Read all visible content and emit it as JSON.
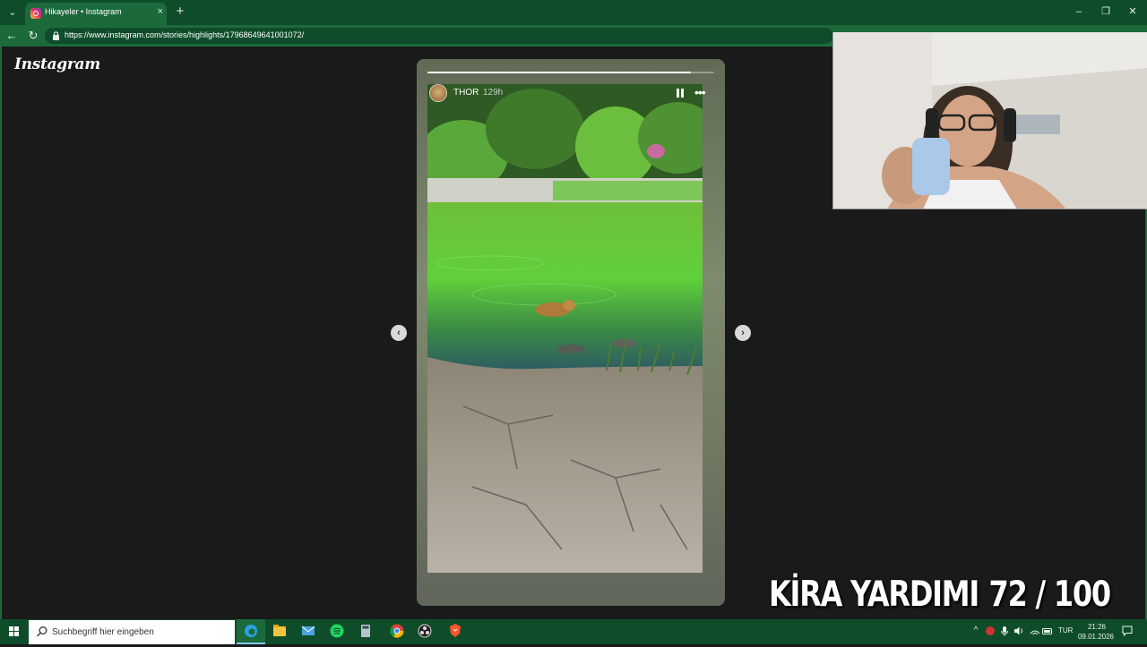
{
  "browser": {
    "tab_title": "Hikayeler • Instagram",
    "url": "https://www.instagram.com/stories/highlights/17968649641001072/",
    "new_tab_label": "+",
    "close_tab_label": "×"
  },
  "instagram": {
    "logo_text": "Instagram",
    "story": {
      "username": "THOR",
      "time_ago": "129h",
      "progress": 0.92
    }
  },
  "overlay": {
    "caption_title": "KİRA YARDIMI",
    "caption_count": "72 / 100"
  },
  "taskbar": {
    "search_placeholder": "Suchbegriff hier eingeben",
    "language": "TUR",
    "time": "21:26",
    "date": "09.01.2026"
  },
  "colors": {
    "browser_dark": "#0f4d2a",
    "browser_light": "#1c6a3c",
    "page_bg": "#1a1a1a"
  }
}
